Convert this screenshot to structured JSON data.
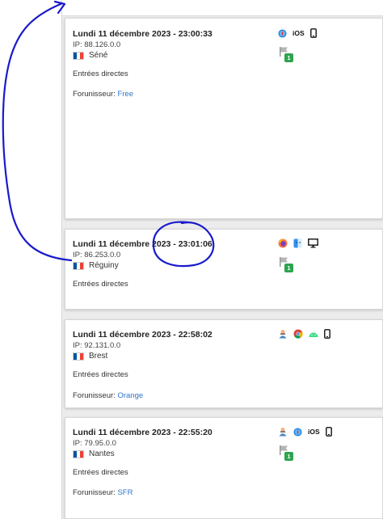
{
  "sessions": [
    {
      "date": "Lundi 11 décembre 2023 - 23:00:33",
      "ip": "IP: 88.126.0.0",
      "location": "Séné",
      "referrer": "Entrées directes",
      "provider_label": "Forunisseur:",
      "provider": "Free",
      "os_label": "iOS",
      "pages_count": "1",
      "icons": [
        "safari-icon",
        "ios-text",
        "mobile-phone-icon"
      ]
    },
    {
      "date": "Lundi 11 décembre 2023 - 23:01:06",
      "ip": "IP: 86.253.0.0",
      "location": "Réguiny",
      "referrer": "Entrées directes",
      "pages_count": "1",
      "icons": [
        "firefox-icon",
        "macos-finder-icon",
        "desktop-monitor-icon"
      ]
    },
    {
      "date": "Lundi 11 décembre 2023 - 22:58:02",
      "ip": "IP: 92.131.0.0",
      "location": "Brest",
      "referrer": "Entrées directes",
      "provider_label": "Forunisseur:",
      "provider": "Orange",
      "icons": [
        "user-agent-icon",
        "chrome-icon",
        "android-icon",
        "mobile-phone-icon"
      ]
    },
    {
      "date": "Lundi 11 décembre 2023 - 22:55:20",
      "ip": "IP: 79.95.0.0",
      "location": "Nantes",
      "referrer": "Entrées directes",
      "provider_label": "Forunisseur:",
      "provider": "SFR",
      "os_label": "iOS",
      "pages_count": "1",
      "icons": [
        "user-agent-icon",
        "safari-icon",
        "ios-text",
        "mobile-phone-icon"
      ]
    }
  ],
  "colors": {
    "link": "#2f76c9",
    "badge": "#2da44e",
    "annotation": "#1a1acc",
    "flag_blue": "#0055a4",
    "flag_red": "#ef4135"
  }
}
